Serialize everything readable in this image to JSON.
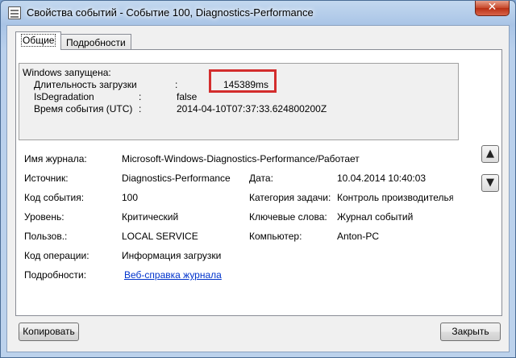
{
  "window": {
    "title": "Свойства событий - Событие 100, Diagnostics-Performance",
    "close_glyph": "✕"
  },
  "tabs": [
    {
      "label": "Общие",
      "active": true
    },
    {
      "label": "Подробности",
      "active": false
    }
  ],
  "description": {
    "header": "Windows запущена:",
    "rows": [
      {
        "label": "Длительность загрузки",
        "sep": ":",
        "value": "145389ms"
      },
      {
        "label": "IsDegradation",
        "sep": ":",
        "value": "false"
      },
      {
        "label": "Время события (UTC)",
        "sep": ":",
        "value": "2014-04-10T07:37:33.624800200Z"
      }
    ]
  },
  "fields": {
    "log_name": {
      "label": "Имя журнала:",
      "value": "Microsoft-Windows-Diagnostics-Performance/Работает"
    },
    "source": {
      "label": "Источник:",
      "value": "Diagnostics-Performance"
    },
    "date": {
      "label": "Дата:",
      "value": "10.04.2014 10:40:03"
    },
    "event_code": {
      "label": "Код события:",
      "value": "100"
    },
    "task_category": {
      "label": "Категория задачи:",
      "value": "Контроль производителья"
    },
    "level": {
      "label": "Уровень:",
      "value": "Критический"
    },
    "keywords": {
      "label": "Ключевые слова:",
      "value": "Журнал событий"
    },
    "user": {
      "label": "Пользов.:",
      "value": "LOCAL SERVICE"
    },
    "computer": {
      "label": "Компьютер:",
      "value": "Anton-PC"
    },
    "opcode": {
      "label": "Код операции:",
      "value": "Информация загрузки"
    },
    "details": {
      "label": "Подробности:",
      "link": "Веб-справка журнала"
    }
  },
  "scroll": {
    "up_glyph": "▲",
    "down_glyph": "▼"
  },
  "buttons": {
    "copy": "Копировать",
    "close": "Закрыть"
  },
  "colors": {
    "highlight": "#d32d2d",
    "link": "#0033cc"
  }
}
